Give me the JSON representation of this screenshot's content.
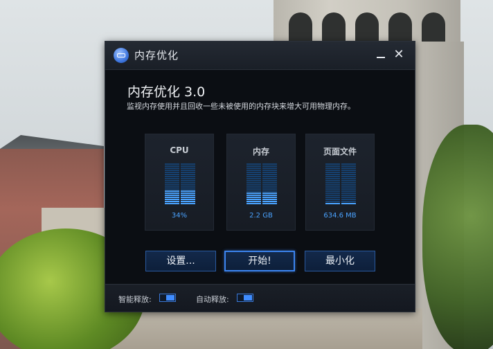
{
  "window": {
    "title": "内存优化",
    "minimize_glyph": "",
    "close_glyph": "✕"
  },
  "main": {
    "heading": "内存优化 3.0",
    "description": "监视内存使用并且回收一些未被使用的内存块来增大可用物理内存。"
  },
  "panels": [
    {
      "label": "CPU",
      "value": "34%",
      "usage_fraction": 0.34
    },
    {
      "label": "内存",
      "value": "2.2 GB",
      "usage_fraction": 0.3
    },
    {
      "label": "页面文件",
      "value": "634.6 MB",
      "usage_fraction": 0.05
    }
  ],
  "buttons": {
    "settings": "设置...",
    "start": "开始!",
    "minimize": "最小化"
  },
  "footer": {
    "smart_release_label": "智能释放:",
    "auto_release_label": "自动释放:"
  },
  "colors": {
    "accent": "#3f8cff",
    "meter_active": "#4aa3ff",
    "meter_inactive": "#16406e",
    "window_bg": "#0b0e13"
  }
}
